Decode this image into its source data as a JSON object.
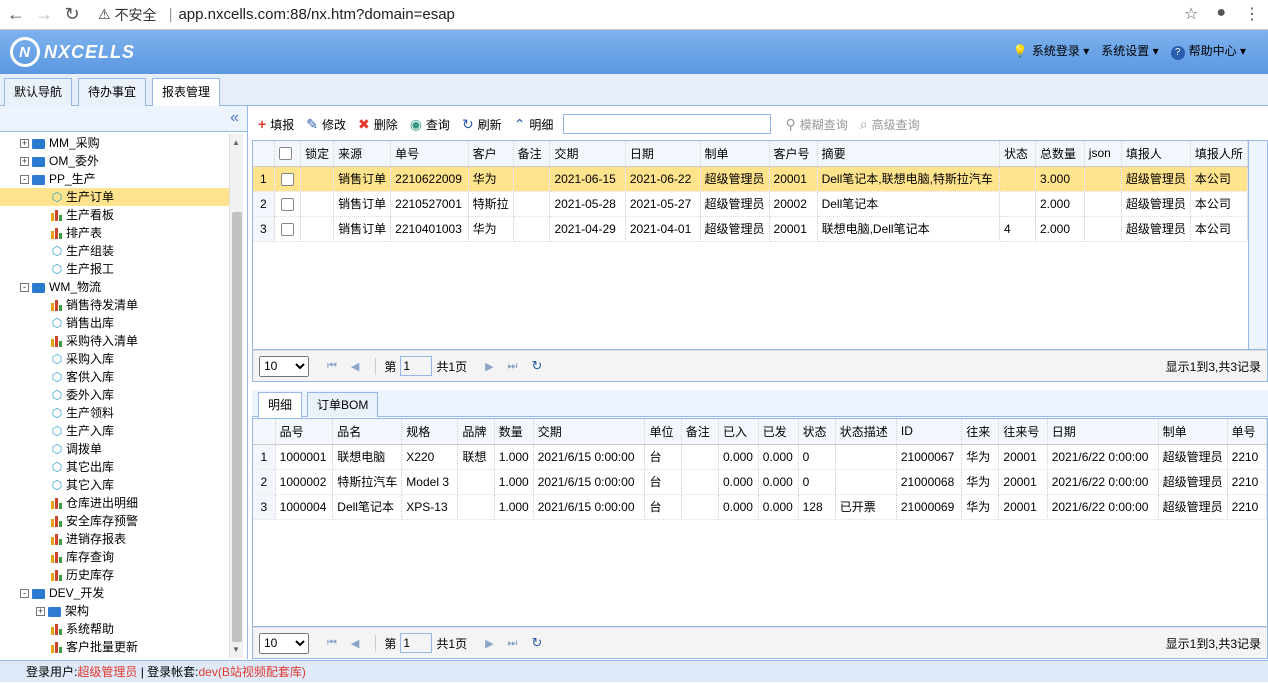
{
  "browser": {
    "warning": "不安全",
    "host": "app.nxcells.com:88/nx.htm?domain=esap"
  },
  "header": {
    "logo_text": "NXCELLS",
    "menu": [
      {
        "icon": "bulb-icon",
        "label": "系统登录"
      },
      {
        "icon": "",
        "label": "系统设置"
      },
      {
        "icon": "help-icon",
        "label": "帮助中心"
      }
    ]
  },
  "tabs": [
    "默认导航",
    "待办事宜",
    "报表管理"
  ],
  "tree": [
    {
      "type": "folder",
      "level": 1,
      "label": "MM_采购",
      "exp": "+"
    },
    {
      "type": "folder",
      "level": 1,
      "label": "OM_委外",
      "exp": "+"
    },
    {
      "type": "folder",
      "level": 1,
      "label": "PP_生产",
      "exp": "-"
    },
    {
      "type": "cube",
      "level": 2,
      "label": "生产订单",
      "selected": true
    },
    {
      "type": "bars",
      "level": 2,
      "label": "生产看板"
    },
    {
      "type": "bars",
      "level": 2,
      "label": "排产表"
    },
    {
      "type": "cube",
      "level": 2,
      "label": "生产组装"
    },
    {
      "type": "cube",
      "level": 2,
      "label": "生产报工"
    },
    {
      "type": "folder",
      "level": 1,
      "label": "WM_物流",
      "exp": "-"
    },
    {
      "type": "bars",
      "level": 2,
      "label": "销售待发清单"
    },
    {
      "type": "cube",
      "level": 2,
      "label": "销售出库"
    },
    {
      "type": "bars",
      "level": 2,
      "label": "采购待入清单"
    },
    {
      "type": "cube",
      "level": 2,
      "label": "采购入库"
    },
    {
      "type": "cube",
      "level": 2,
      "label": "客供入库"
    },
    {
      "type": "cube",
      "level": 2,
      "label": "委外入库"
    },
    {
      "type": "cube",
      "level": 2,
      "label": "生产领料"
    },
    {
      "type": "cube",
      "level": 2,
      "label": "生产入库"
    },
    {
      "type": "cube",
      "level": 2,
      "label": "调拨单"
    },
    {
      "type": "cube",
      "level": 2,
      "label": "其它出库"
    },
    {
      "type": "cube",
      "level": 2,
      "label": "其它入库"
    },
    {
      "type": "bars",
      "level": 2,
      "label": "仓库进出明细"
    },
    {
      "type": "bars",
      "level": 2,
      "label": "安全库存预警"
    },
    {
      "type": "bars",
      "level": 2,
      "label": "进销存报表"
    },
    {
      "type": "bars",
      "level": 2,
      "label": "库存查询"
    },
    {
      "type": "bars",
      "level": 2,
      "label": "历史库存"
    },
    {
      "type": "folder",
      "level": 1,
      "label": "DEV_开发",
      "exp": "-"
    },
    {
      "type": "folder",
      "level": 2,
      "label": "架构",
      "exp": "+"
    },
    {
      "type": "bars",
      "level": 2,
      "label": "系统帮助"
    },
    {
      "type": "bars",
      "level": 2,
      "label": "客户批量更新"
    }
  ],
  "toolbar": {
    "add": "填报",
    "edit": "修改",
    "delete": "删除",
    "query": "查询",
    "refresh": "刷新",
    "detail": "明细",
    "search_value": "",
    "fuzzy": "模糊查询",
    "advanced": "高级查询"
  },
  "main_grid": {
    "columns": [
      "锁定",
      "来源",
      "单号",
      "客户",
      "备注",
      "交期",
      "日期",
      "制单",
      "客户号",
      "摘要",
      "状态",
      "总数量",
      "json",
      "填报人",
      "填报人所"
    ],
    "rows": [
      [
        "",
        "销售订单",
        "2210622009",
        "华为",
        "",
        "2021-06-15",
        "2021-06-22",
        "超级管理员",
        "20001",
        "Dell笔记本,联想电脑,特斯拉汽车",
        "",
        "3.000",
        "",
        "超级管理员",
        "本公司"
      ],
      [
        "",
        "销售订单",
        "2210527001",
        "特斯拉",
        "",
        "2021-05-28",
        "2021-05-27",
        "超级管理员",
        "20002",
        "Dell笔记本",
        "",
        "2.000",
        "",
        "超级管理员",
        "本公司"
      ],
      [
        "",
        "销售订单",
        "2210401003",
        "华为",
        "",
        "2021-04-29",
        "2021-04-01",
        "超级管理员",
        "20001",
        "联想电脑,Dell笔记本",
        "4",
        "2.000",
        "",
        "超级管理员",
        "本公司"
      ]
    ]
  },
  "pager1": {
    "size": "10",
    "page_label": "第",
    "page": "1",
    "total": "共1页",
    "info": "显示1到3,共3记录"
  },
  "detail_tabs": [
    "明细",
    "订单BOM"
  ],
  "detail_grid": {
    "columns": [
      "品号",
      "品名",
      "规格",
      "品牌",
      "数量",
      "交期",
      "单位",
      "备注",
      "已入",
      "已发",
      "状态",
      "状态描述",
      "ID",
      "往来",
      "往来号",
      "日期",
      "制单",
      "单号"
    ],
    "rows": [
      [
        "1000001",
        "联想电脑",
        "X220",
        "联想",
        "1.000",
        "2021/6/15 0:00:00",
        "台",
        "",
        "0.000",
        "0.000",
        "0",
        "",
        "21000067",
        "华为",
        "20001",
        "2021/6/22 0:00:00",
        "超级管理员",
        "2210"
      ],
      [
        "1000002",
        "特斯拉汽车",
        "Model 3",
        "",
        "1.000",
        "2021/6/15 0:00:00",
        "台",
        "",
        "0.000",
        "0.000",
        "0",
        "",
        "21000068",
        "华为",
        "20001",
        "2021/6/22 0:00:00",
        "超级管理员",
        "2210"
      ],
      [
        "1000004",
        "Dell笔记本",
        "XPS-13",
        "",
        "1.000",
        "2021/6/15 0:00:00",
        "台",
        "",
        "0.000",
        "0.000",
        "128",
        "已开票",
        "21000069",
        "华为",
        "20001",
        "2021/6/22 0:00:00",
        "超级管理员",
        "2210"
      ]
    ]
  },
  "pager2": {
    "size": "10",
    "page_label": "第",
    "page": "1",
    "total": "共1页",
    "info": "显示1到3,共3记录"
  },
  "status": {
    "user_label": "登录用户:",
    "user": "超级管理员",
    "sep": " | ",
    "account_label": "登录帐套:",
    "account": "dev(B站视频配套库)"
  }
}
